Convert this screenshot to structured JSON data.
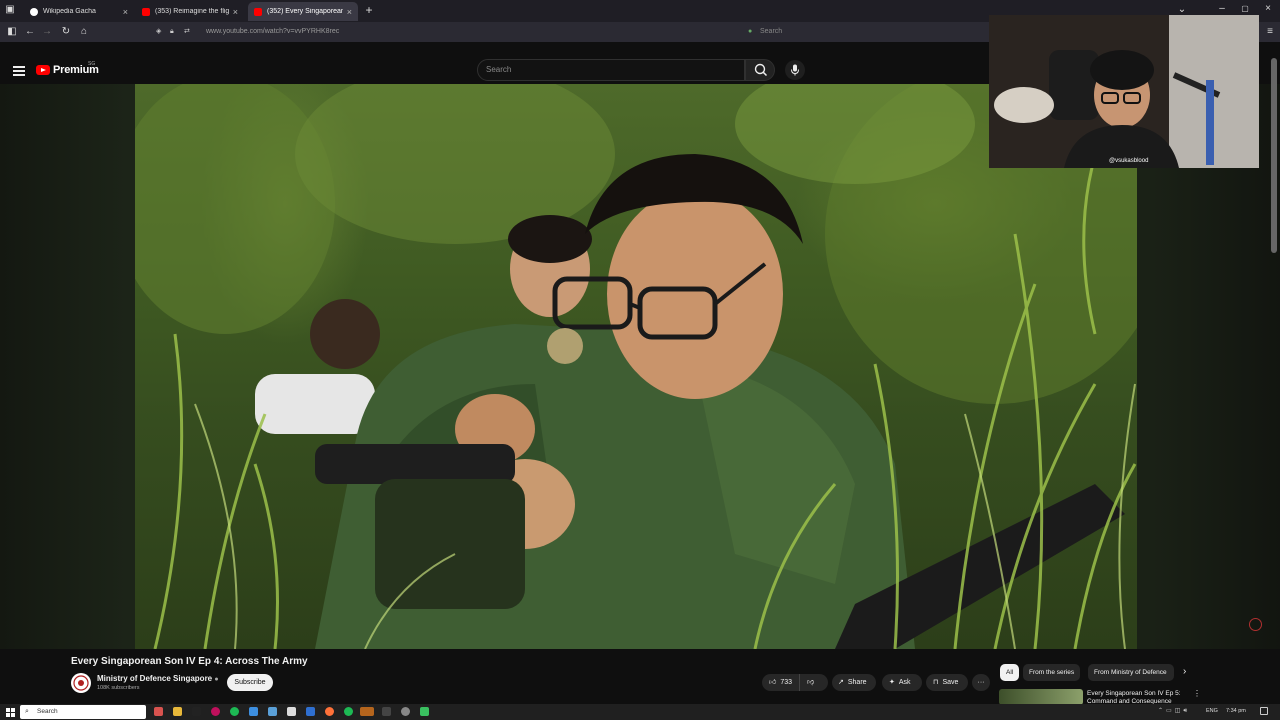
{
  "tabs": [
    {
      "label": "Wikipedia Gacha",
      "color": "#ffffff"
    },
    {
      "label": "(353) Reimagine the flight ·",
      "color": "#ff0000"
    },
    {
      "label": "(352) Every Singaporean So",
      "color": "#ff0000",
      "active": true
    }
  ],
  "address_bar": {
    "url": "www.youtube.com/watch?v=vvPYRHK8rec"
  },
  "browser_search": {
    "placeholder": "Search"
  },
  "youtube": {
    "logo_text": "Premium",
    "region": "SG",
    "search_placeholder": "Search"
  },
  "webcam": {
    "handle": "@vsukasblood"
  },
  "video": {
    "title": "Every Singaporean Son IV Ep 4: Across The Army",
    "channel": "Ministry of Defence Singapore",
    "subscribers": "108K subscribers",
    "subscribe_label": "Subscribe",
    "like_count": "733",
    "share_label": "Share",
    "ask_label": "Ask",
    "save_label": "Save"
  },
  "chips": [
    {
      "label": "All",
      "active": true
    },
    {
      "label": "From the series"
    },
    {
      "label": "From Ministry of Defence"
    }
  ],
  "recommendation": {
    "title": "Every Singaporean Son IV Ep 5: Command and Consequence"
  },
  "taskbar": {
    "search_placeholder": "Search",
    "language": "ENG",
    "time": "7:34 pm"
  },
  "colors": {
    "youtube_red": "#ff0000",
    "background": "#0f0f0f",
    "tab_active": "#3a3944"
  }
}
